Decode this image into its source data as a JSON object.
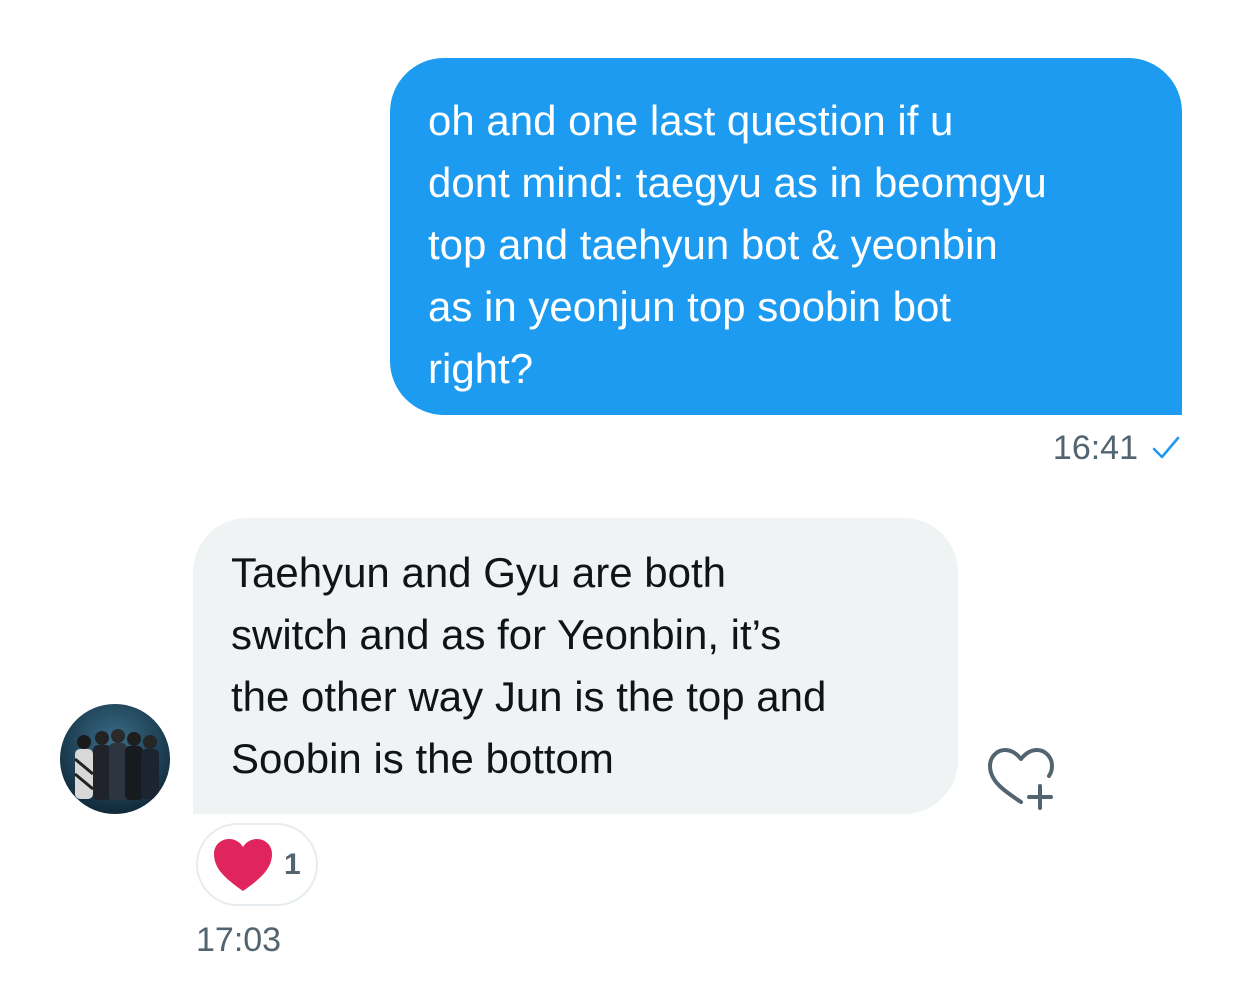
{
  "outgoing_message": {
    "text": "oh and one last question if u\ndont mind: taegyu as in beomgyu\ntop and taehyun bot & yeonbin\nas in yeonjun top soobin bot\nright?",
    "time": "16:41",
    "status_icon": "check-icon",
    "bubble_color": "#1d9bf0"
  },
  "incoming_message": {
    "text": "Taehyun and Gyu are both\nswitch and as for Yeonbin, it’s\nthe other way Jun is the top and\nSoobin is the bottom",
    "time": "17:03",
    "avatar_icon": "group-photo-avatar",
    "bubble_color": "#eff3f4",
    "reaction": {
      "icon": "heart-icon",
      "count": "1",
      "color": "#e0245e"
    },
    "add_reaction_icon": "heart-plus-icon"
  }
}
